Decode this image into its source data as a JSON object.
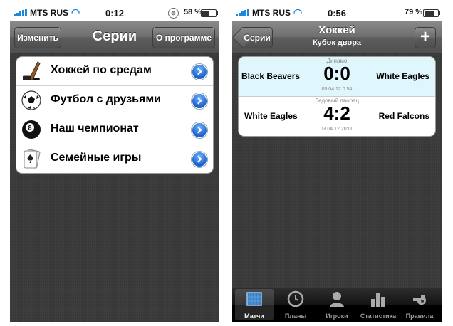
{
  "left_screen": {
    "status": {
      "carrier": "MTS RUS",
      "time": "0:12",
      "battery": "58 %",
      "battery_level": 0.58
    },
    "nav": {
      "edit_button": "Изменить",
      "title": "Серии",
      "about_button": "О программе"
    },
    "series": [
      {
        "label": "Хоккей по средам",
        "icon": "hockey-stick-icon"
      },
      {
        "label": "Футбол с друзьями",
        "icon": "soccer-ball-icon"
      },
      {
        "label": "Наш чемпионат",
        "icon": "eight-ball-icon"
      },
      {
        "label": "Семейные игры",
        "icon": "playing-card-icon"
      }
    ]
  },
  "right_screen": {
    "status": {
      "carrier": "MTS RUS",
      "time": "0:56",
      "battery": "79 %",
      "battery_level": 0.79
    },
    "nav": {
      "back_button": "Серии",
      "title": "Хоккей",
      "subtitle": "Кубок двора",
      "add_button": "+"
    },
    "matches": [
      {
        "venue": "Динамо",
        "team_left": "Black Beavers",
        "score": "0:0",
        "team_right": "White Eagles",
        "date": "05.04.12  0:54"
      },
      {
        "venue": "Ледовый дворец",
        "team_left": "White Eagles",
        "score": "4:2",
        "team_right": "Red Falcons",
        "date": "03.04.12  20:00"
      }
    ],
    "tabs": [
      {
        "label": "Матчи",
        "icon": "hockey-goal-icon",
        "active": true
      },
      {
        "label": "Планы",
        "icon": "clock-icon",
        "active": false
      },
      {
        "label": "Игроки",
        "icon": "person-icon",
        "active": false
      },
      {
        "label": "Статистика",
        "icon": "bar-chart-icon",
        "active": false
      },
      {
        "label": "Правила",
        "icon": "whistle-icon",
        "active": false
      }
    ]
  }
}
